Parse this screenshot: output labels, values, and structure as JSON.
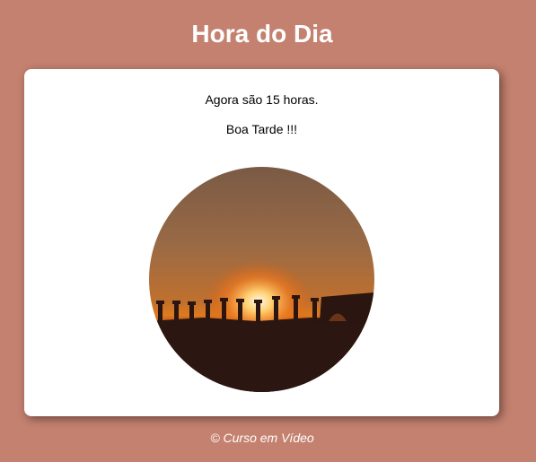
{
  "page": {
    "title": "Hora do Dia",
    "background_color": "#c4816f"
  },
  "card": {
    "time_message": "Agora são 15 horas.",
    "greeting": "Boa Tarde !!!",
    "image": {
      "name": "afternoon-sunset-photo",
      "description_icon": "sunset-photo"
    }
  },
  "footer": {
    "credit": "© Curso em Vídeo"
  }
}
